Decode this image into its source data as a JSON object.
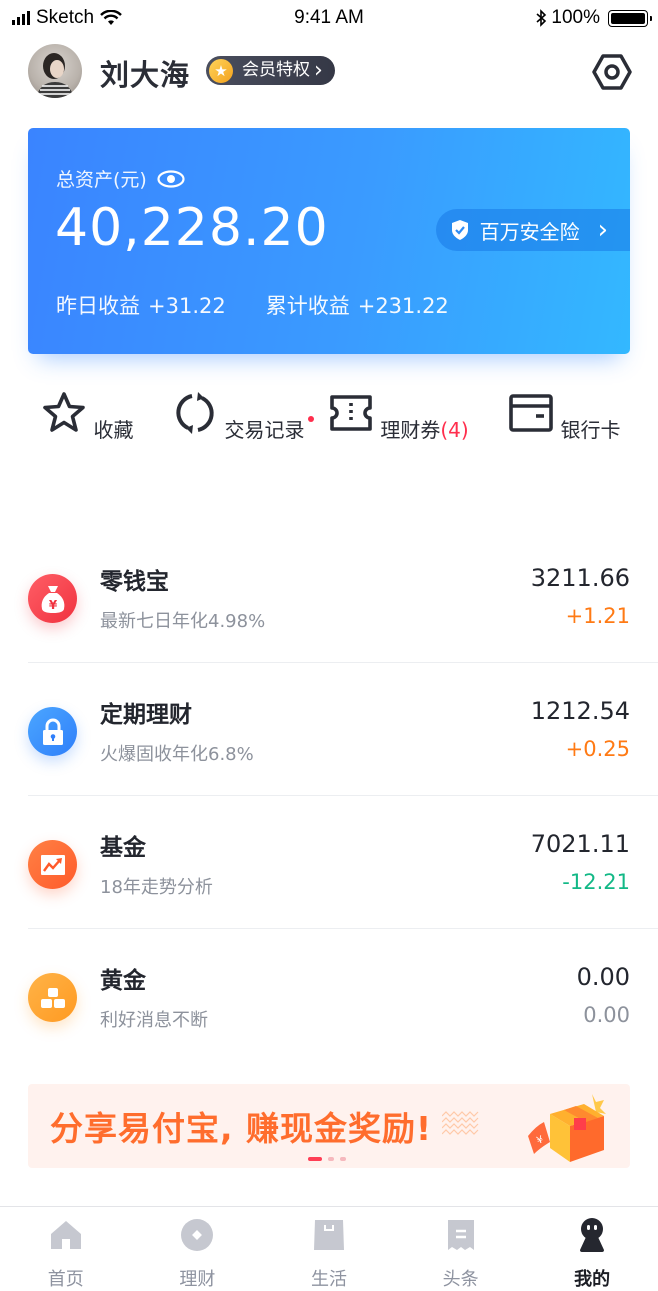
{
  "status_bar": {
    "carrier": "Sketch",
    "time": "9:41 AM",
    "battery": "100%"
  },
  "header": {
    "user_name": "刘大海",
    "vip_label": "会员特权",
    "vip_chevron": "›"
  },
  "asset_card": {
    "label": "总资产(元)",
    "total": "40,228.20",
    "insurance_label": "百万安全险",
    "insurance_chevron": "›",
    "yesterday_label": "昨日收益",
    "yesterday_value": "+31.22",
    "cumulative_label": "累计收益",
    "cumulative_value": "+231.22"
  },
  "quick_actions": [
    {
      "label": "收藏",
      "icon": "star-icon"
    },
    {
      "label": "交易记录",
      "icon": "refresh-icon",
      "has_dot": true
    },
    {
      "label": "理财券",
      "count": "(4)",
      "icon": "ticket-icon"
    },
    {
      "label": "银行卡",
      "icon": "card-icon"
    }
  ],
  "products": [
    {
      "title": "零钱宝",
      "subtitle": "最新七日年化4.98%",
      "amount": "3211.66",
      "change": "+1.21",
      "change_color": "#ff7a14",
      "icon": "money-bag-icon",
      "icon_color": "#f5424f"
    },
    {
      "title": "定期理财",
      "subtitle": "火爆固收年化6.8%",
      "amount": "1212.54",
      "change": "+0.25",
      "change_color": "#ff7a14",
      "icon": "lock-icon",
      "icon_color": "#3a8ffd"
    },
    {
      "title": "基金",
      "subtitle": "18年走势分析",
      "amount": "7021.11",
      "change": "-12.21",
      "change_color": "#12b886",
      "icon": "trend-chart-icon",
      "icon_color": "#ff6a33"
    },
    {
      "title": "黄金",
      "subtitle": "利好消息不断",
      "amount": "0.00",
      "change": "0.00",
      "change_color": "#8d929c",
      "icon": "gold-bars-icon",
      "icon_color": "#ffa330"
    }
  ],
  "banner": {
    "text": "分享易付宝, 赚现金奖励!",
    "slide_count": 3,
    "active_slide": 1
  },
  "tab_bar": [
    {
      "label": "首页",
      "icon": "home-icon",
      "active": false
    },
    {
      "label": "理财",
      "icon": "coin-icon",
      "active": false
    },
    {
      "label": "生活",
      "icon": "shopping-bag-icon",
      "active": false
    },
    {
      "label": "头条",
      "icon": "news-icon",
      "active": false
    },
    {
      "label": "我的",
      "icon": "profile-icon",
      "active": true
    }
  ],
  "colors": {
    "brand_blue": "#3a8fff",
    "accent_red": "#ff2e4d",
    "gain_orange": "#ff7a14",
    "loss_green": "#12b886",
    "text_dark": "#23262e",
    "text_muted": "#8d929c"
  }
}
